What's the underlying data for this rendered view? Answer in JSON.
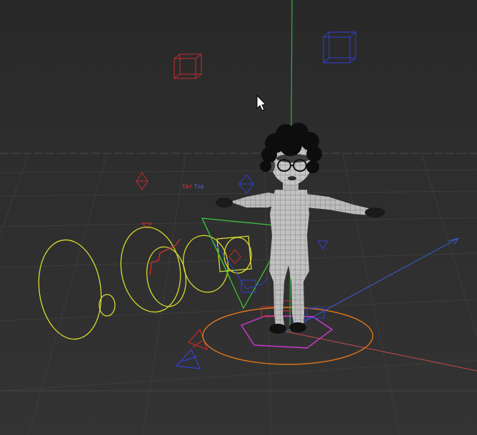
{
  "viewport": {
    "background_top": "#2a2a2a",
    "background_bottom": "#303030",
    "floor_color": "#2d2d2d",
    "grid_color": "#3a3a3a"
  },
  "scene": {
    "floating_label_a": "tbr",
    "floating_label_b": "Top",
    "colors": {
      "axis_x": "#d04a4a",
      "axis_y": "#35b045",
      "axis_z": "#3b5ed8",
      "ik_controls": "#d8dc2e",
      "root_ring": "#e07818",
      "hip_control": "#d23ad2",
      "camera_frustum": "#3cc83c",
      "locator_red": "#cc2a2a",
      "locator_blue": "#3040d8"
    }
  },
  "cursor": {
    "icon": "mouse-pointer-icon"
  }
}
